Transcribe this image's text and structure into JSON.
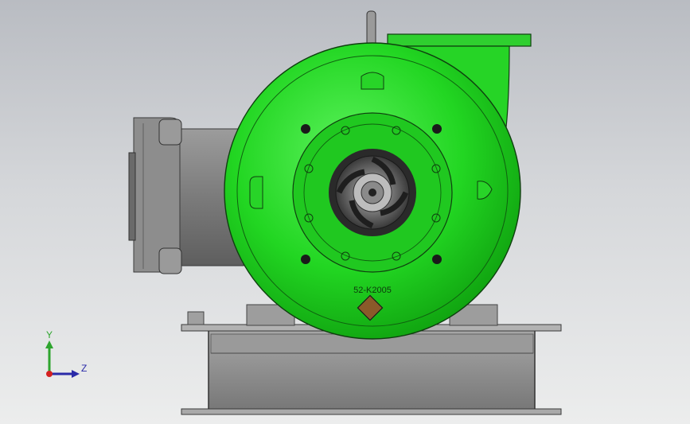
{
  "model": {
    "part_number": "52-K2005",
    "body_color": "#22dd22",
    "body_dark": "#0a8a0a",
    "frame_color": "#8a8a8a",
    "background_top": "#b9bcc2",
    "background_bottom": "#eceded"
  },
  "triad": {
    "y_label": "Y",
    "z_label": "Z",
    "y_color": "#2ea52e",
    "z_color": "#2a2aa8",
    "x_color": "#d42020"
  }
}
